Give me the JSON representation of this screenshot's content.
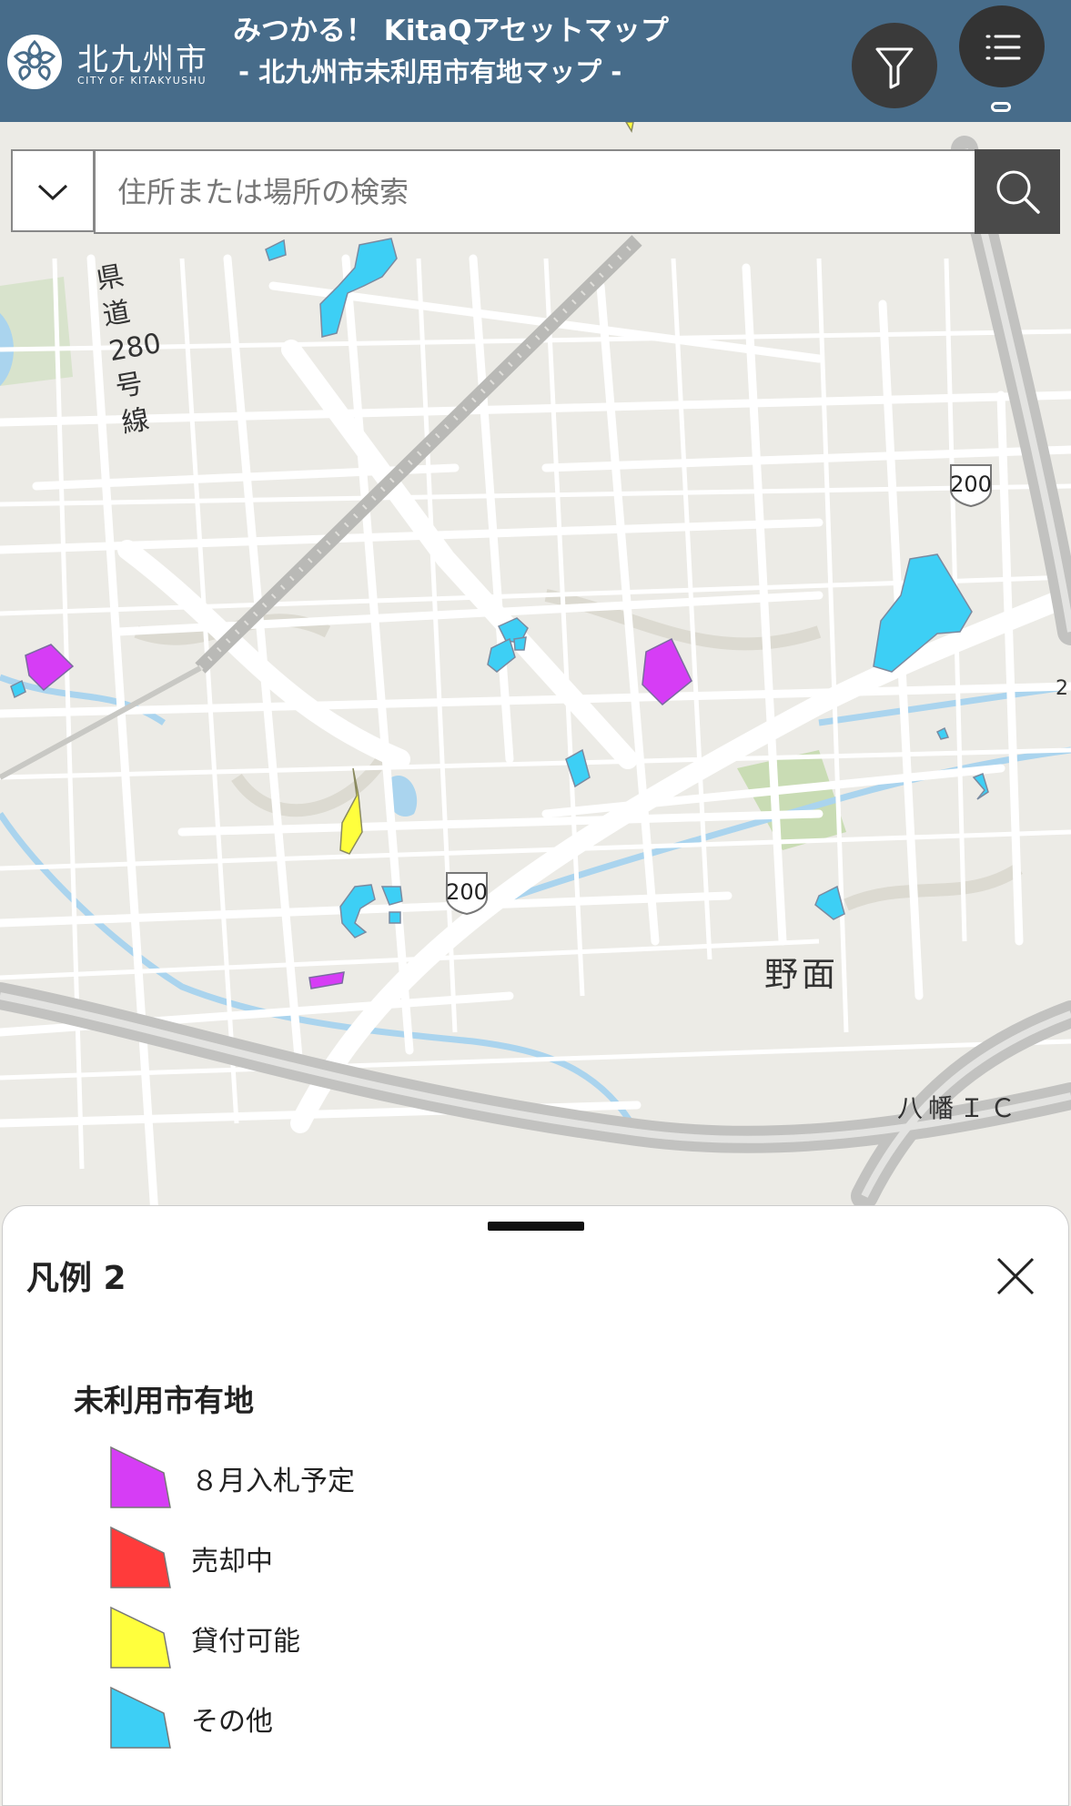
{
  "header": {
    "logo_jp": "北九州市",
    "logo_en": "CITY OF KITAKYUSHU",
    "title_line1": "みつかる！ KitaQアセットマップ",
    "title_line2": "- 北九州市未利用市有地マップ -"
  },
  "search": {
    "placeholder": "住所または場所の検索"
  },
  "map": {
    "labels": {
      "prefectural_road": "県道280号線",
      "route_shield": "200",
      "route_shield_2": "200",
      "area_name": "野面",
      "interchange": "八幡ＩＣ",
      "edge_label": "2"
    }
  },
  "legend": {
    "title": "凡例 2",
    "section_title": "未利用市有地",
    "items": [
      {
        "label": "８月入札予定",
        "color": "#d63df5"
      },
      {
        "label": "売却中",
        "color": "#ff3b3b"
      },
      {
        "label": "貸付可能",
        "color": "#ffff3d"
      },
      {
        "label": "その他",
        "color": "#3dcff5"
      }
    ]
  },
  "colors": {
    "header_bg": "#476c8a",
    "parcel_other": "#3dcff5",
    "parcel_august": "#d63df5",
    "parcel_lease": "#ffff3d"
  }
}
